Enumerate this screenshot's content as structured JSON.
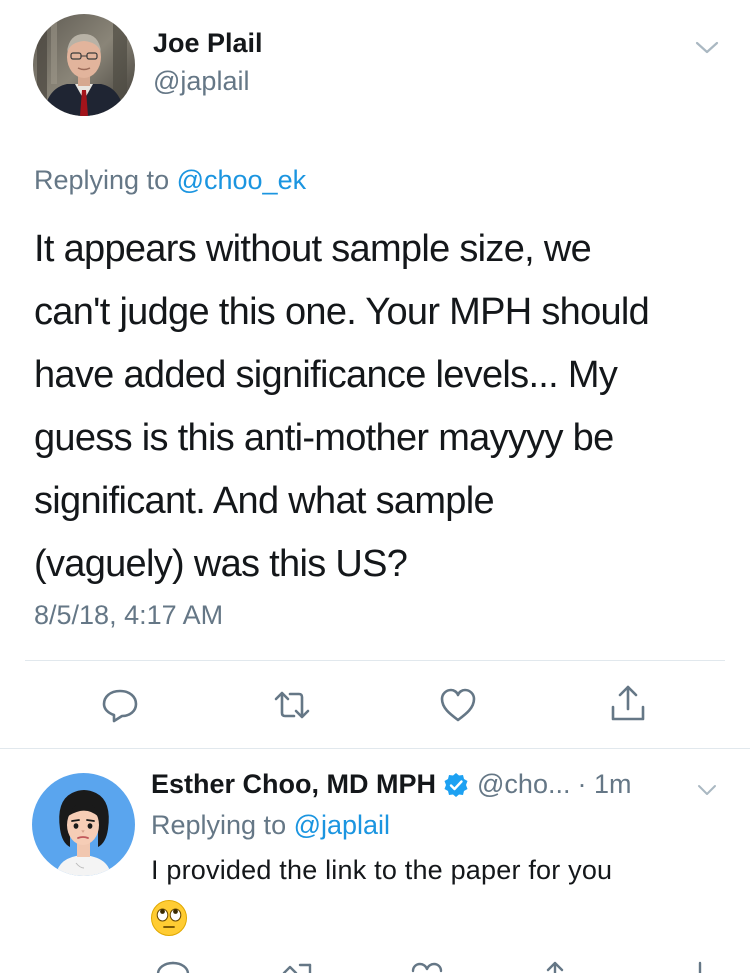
{
  "main_tweet": {
    "name": "Joe Plail",
    "handle": "@japlail",
    "replying_prefix": "Replying to ",
    "replying_to": "@choo_ek",
    "text_lines": [
      "It appears without sample size, we",
      "can't judge this one.  Your MPH should",
      "have added significance levels... My",
      "guess is this anti-mother mayyyy be",
      "significant.  And what sample",
      "(vaguely) was this US?"
    ],
    "timestamp": "8/5/18, 4:17 AM",
    "avatar_icon": "person-photo-avatar",
    "actions": [
      "reply-icon",
      "retweet-icon",
      "like-icon",
      "share-icon"
    ]
  },
  "reply_tweet": {
    "name": "Esther Choo, MD MPH",
    "verified": true,
    "handle": "@cho...",
    "time": "· 1m",
    "replying_prefix": "Replying to ",
    "replying_to": "@japlail",
    "text": "I provided the link to the paper for you",
    "emoji": "face-with-rolling-eyes",
    "avatar_icon": "cartoon-avatar"
  },
  "colors": {
    "text": "#14171a",
    "secondary": "#657786",
    "link": "#1b95e0",
    "divider": "#e1e8ed",
    "verified": "#1da1f2"
  }
}
